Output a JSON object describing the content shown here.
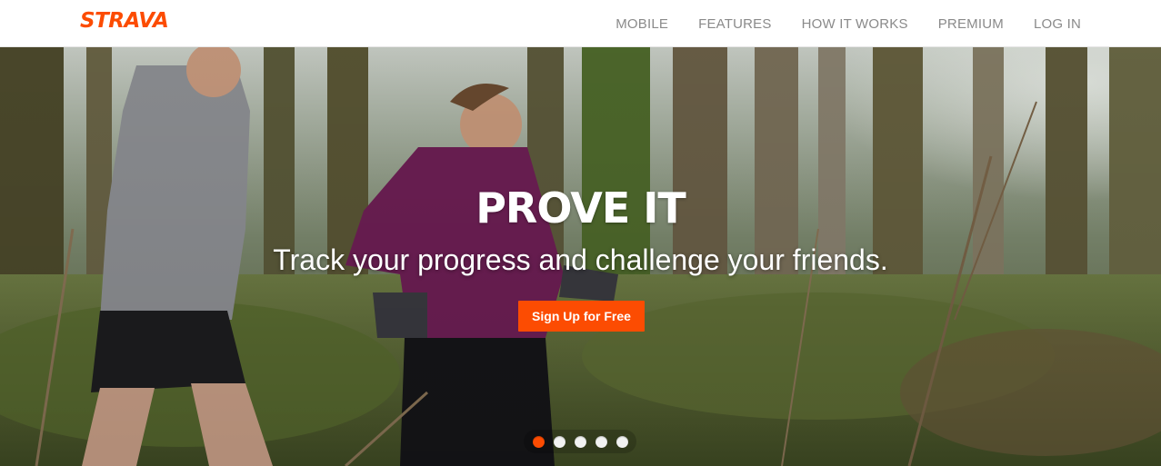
{
  "brand": {
    "logo_text": "STRAVA",
    "accent_color": "#fc4c02"
  },
  "nav": {
    "items": [
      {
        "label": "MOBILE"
      },
      {
        "label": "FEATURES"
      },
      {
        "label": "HOW IT WORKS"
      },
      {
        "label": "PREMIUM"
      },
      {
        "label": "LOG IN"
      }
    ]
  },
  "hero": {
    "title": "PROVE IT",
    "subtitle": "Track your progress and challenge your friends.",
    "cta_label": "Sign Up for Free",
    "slide_count": 5,
    "active_slide": 1
  }
}
